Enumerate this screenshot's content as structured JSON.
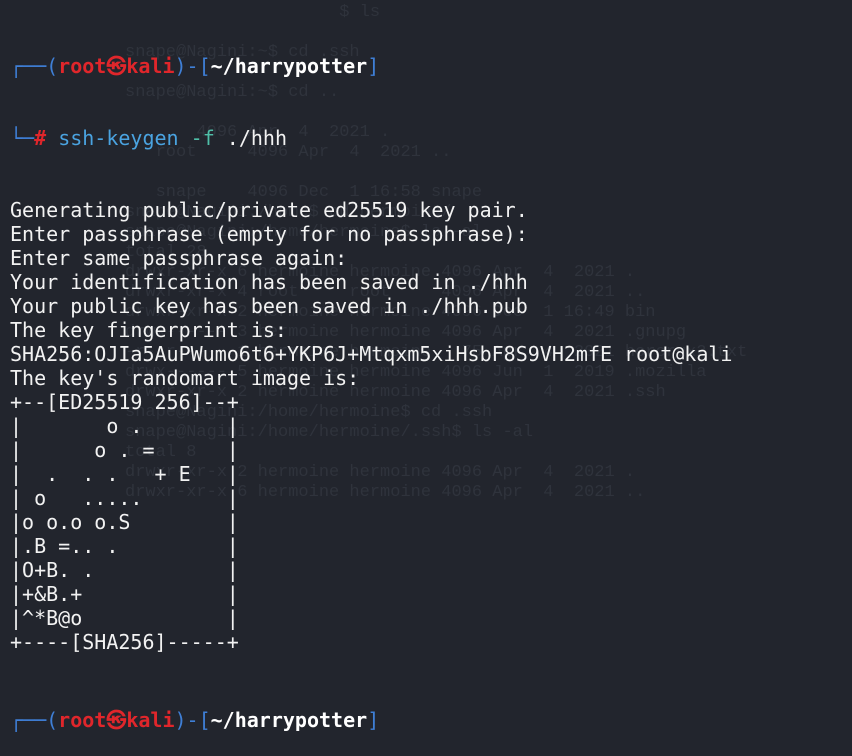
{
  "prompt": {
    "corner_top": "┌──(",
    "user": "root",
    "skull": "㉿",
    "host": "kali",
    "mid": ")-[",
    "path": "~/harrypotter",
    "close": "]",
    "corner_bottom": "└─",
    "symbol": "#"
  },
  "command": {
    "name": "ssh-keygen",
    "flag": "-f",
    "arg": "./hhh"
  },
  "output": [
    "Generating public/private ed25519 key pair.",
    "Enter passphrase (empty for no passphrase):",
    "Enter same passphrase again:",
    "Your identification has been saved in ./hhh",
    "Your public key has been saved in ./hhh.pub",
    "The key fingerprint is:",
    "SHA256:OJIa5AuPWumo6t6+YKP6J+Mtqxm5xiHsbF8S9VH2mfE root@kali",
    "The key's randomart image is:",
    "+--[ED25519 256]--+",
    "|       o .       |",
    "|      o . =      |",
    "|  .  . .   + E   |",
    "| o   .....       |",
    "|o o.o o.S        |",
    "|.B =.. .         |",
    "|O+B. .           |",
    "|+&B.+            |",
    "|^*B@o            |",
    "+----[SHA256]-----+"
  ],
  "background_ghost": [
    "                     $ ls",
    "",
    "snape@Nagini:~$ cd .ssh",
    "",
    "snape@Nagini:~$ cd ..",
    "",
    "       4096 Apr  4  2021 .",
    "   root     4096 Apr  4  2021 ..",
    "",
    "   snape    4096 Dec  1 16:58 snape",
    "snape@Nagini:/home$ cd hermoine/",
    "snape@Nagini:/home/hermoine$ ls -al",
    "total 28",
    "drwxr-xr-x 6 hermoine hermoine 4096 Apr  4  2021 .",
    "drwxr-xr-x 4 root     root     4096 Apr  4  2021 ..",
    "drwxr-xr-x 2 hermoine hermoine 4096 Dec  1 16:49 bin",
    "drwx------ 3 hermoine hermoine 4096 Apr  4  2021 .gnupg",
    "-r--r----- 1 hermoine hermoine   75 Apr  4  2021 horcrux2.txt",
    "drwx------ 5 hermoine hermoine 4096 Jun  1  2019 .mozilla",
    "drwxr-xr-x 2 hermoine hermoine 4096 Apr  4  2021 .ssh",
    "snape@Nagini:/home/hermoine$ cd .ssh",
    "snape@Nagini:/home/hermoine/.ssh$ ls -al",
    "total 8",
    "drwxr-xr-x 2 hermoine hermoine 4096 Apr  4  2021 .",
    "drwxr-xr-x 6 hermoine hermoine 4096 Apr  4  2021 .."
  ],
  "colors": {
    "background": "#22252d",
    "prompt_frame": "#3f7fd6",
    "prompt_user": "#e0262b",
    "command": "#4aa3e0",
    "flag": "#4fbfa8",
    "text": "#f2f2f2"
  }
}
